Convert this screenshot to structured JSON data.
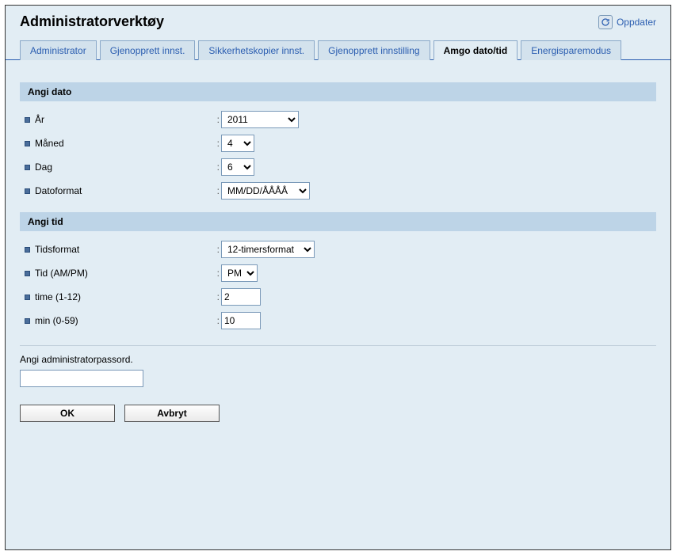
{
  "title": "Administratorverktøy",
  "update_label": "Oppdater",
  "tabs": [
    {
      "label": "Administrator"
    },
    {
      "label": "Gjenopprett innst."
    },
    {
      "label": "Sikkerhetskopier innst."
    },
    {
      "label": "Gjenopprett innstilling"
    },
    {
      "label": "Amgo dato/tid"
    },
    {
      "label": "Energisparemodus"
    }
  ],
  "section_date": "Angi dato",
  "section_time": "Angi tid",
  "date": {
    "year_label": "År",
    "year_value": "2011",
    "month_label": "Måned",
    "month_value": "4",
    "day_label": "Dag",
    "day_value": "6",
    "fmt_label": "Datoformat",
    "fmt_value": "MM/DD/ÅÅÅÅ"
  },
  "time": {
    "fmt_label": "Tidsformat",
    "fmt_value": "12-timersformat",
    "ampm_label": "Tid (AM/PM)",
    "ampm_value": "PM",
    "hour_label": "time (1-12)",
    "hour_value": "2",
    "min_label": "min (0-59)",
    "min_value": "10"
  },
  "password_label": "Angi administratorpassord.",
  "ok_label": "OK",
  "cancel_label": "Avbryt"
}
